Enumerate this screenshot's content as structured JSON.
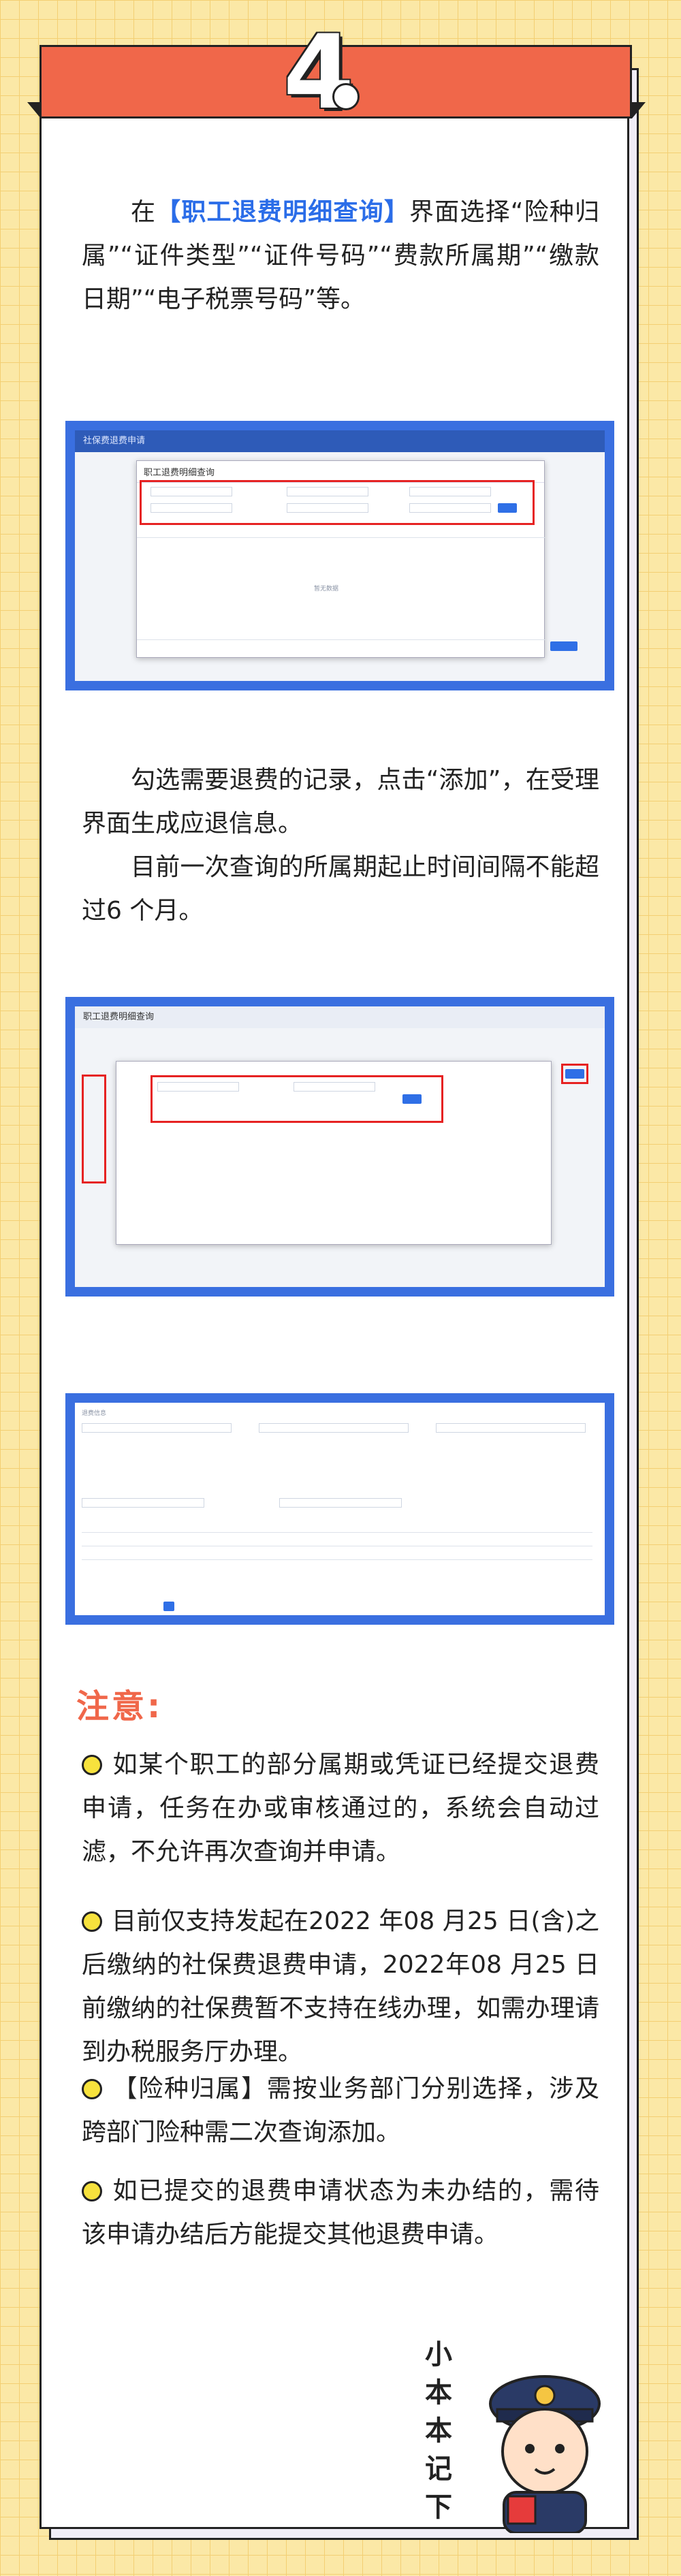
{
  "section": {
    "number": "4"
  },
  "intro": {
    "prefix": "在",
    "highlight": "【职工退费明细查询】",
    "suffix": "界面选择“险种归属”“证件类型”“证件号码”“费款所属期”“缴款日期”“电子税票号码”等。"
  },
  "step2": {
    "line1": "勾选需要退费的记录，点击“添加”，在受理界面生成应退信息。",
    "line2": "目前一次查询的所属期起止时间间隔不能超过6 个月。"
  },
  "screenshots": {
    "shot1": {
      "window_title": "社保费退费申请",
      "modal_title": "职工退费明细查询",
      "add_button": "添加",
      "empty_text": "暂无数据"
    },
    "shot2": {
      "window_title": "职工退费明细查询",
      "add_button": "添加"
    },
    "shot3": {
      "section_label": "退费信息"
    }
  },
  "notice": {
    "title": "注意:",
    "items": [
      "如某个职工的部分属期或凭证已经提交退费申请，任务在办或审核通过的，系统会自动过滤，不允许再次查询并申请。",
      "目前仅支持发起在2022 年08 月25 日(含)之后缴纳的社保费退费申请，2022年08 月25 日前缴纳的社保费暂不支持在线办理，如需办理请到办税服务厅办理。",
      "【险种归属】需按业务部门分别选择，涉及跨部门险种需二次查询添加。",
      "如已提交的退费申请状态为未办结的，需待该申请办结后方能提交其他退费申请。"
    ]
  },
  "mascot": {
    "caption": "小本本记下"
  },
  "colors": {
    "accent": "#f0674a",
    "highlight": "#2b6de8",
    "frame": "#3a6fe0",
    "bullet": "#f7e23d",
    "background": "#fbe8a6"
  }
}
